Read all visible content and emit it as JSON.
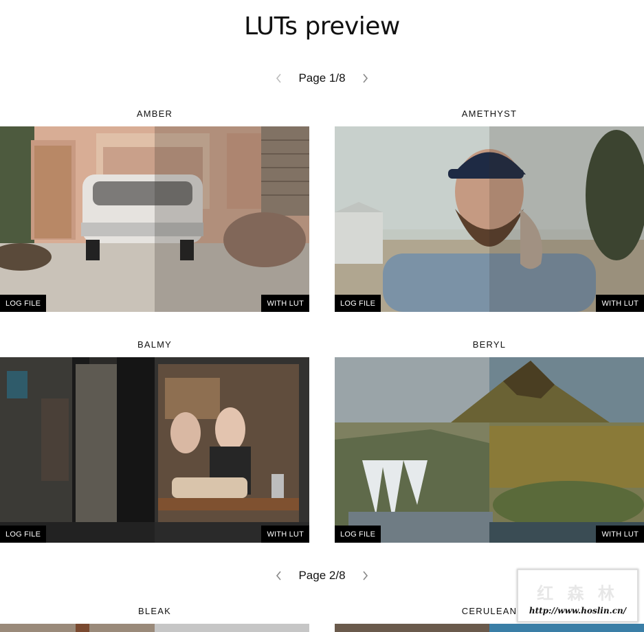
{
  "page": {
    "title": "LUTs preview"
  },
  "pagers": [
    {
      "label": "Page 1/8",
      "prev_icon": "chevron-left-icon",
      "next_icon": "chevron-right-icon"
    },
    {
      "label": "Page 2/8",
      "prev_icon": "chevron-left-icon",
      "next_icon": "chevron-right-icon"
    }
  ],
  "cards": [
    {
      "name": "AMBER",
      "left_tag": "LOG FILE",
      "right_tag": "WITH LUT"
    },
    {
      "name": "AMETHYST",
      "left_tag": "LOG FILE",
      "right_tag": "WITH LUT"
    },
    {
      "name": "BALMY",
      "left_tag": "LOG FILE",
      "right_tag": "WITH LUT"
    },
    {
      "name": "BERYL",
      "left_tag": "LOG FILE",
      "right_tag": "WITH LUT"
    },
    {
      "name": "BLEAK"
    },
    {
      "name": "CERULEAN"
    }
  ],
  "watermark": {
    "cjk": "红 森 林",
    "url": "http://www.hoslin.cn/"
  },
  "colors": {
    "tag_bg": "#000000",
    "tag_text": "#ffffff",
    "chevron": "#888888"
  }
}
